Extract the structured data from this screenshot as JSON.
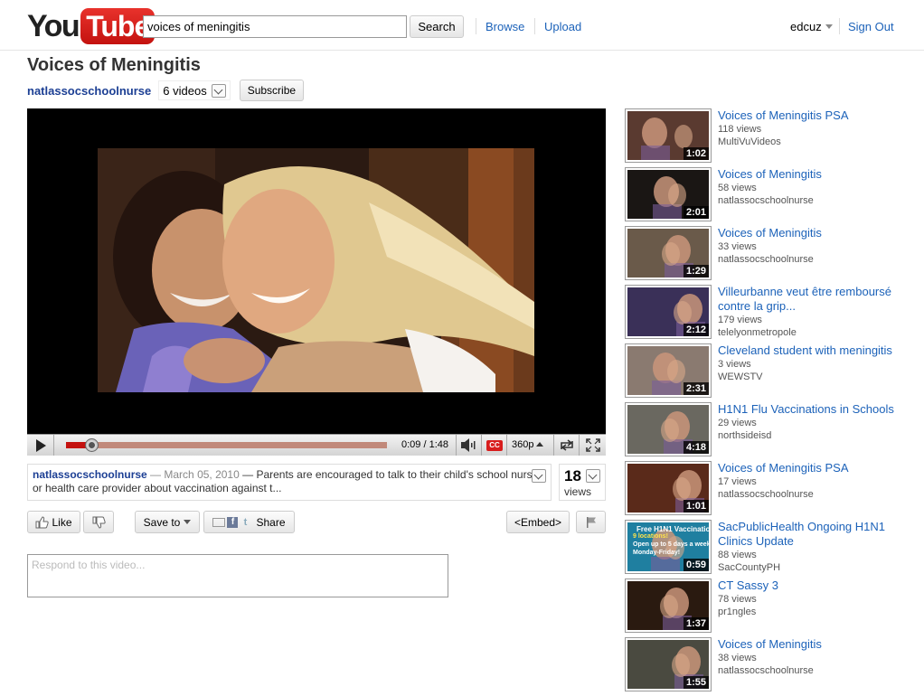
{
  "header": {
    "logo_you": "You",
    "logo_tube": "Tube",
    "search_value": "voices of meningitis",
    "search_button": "Search",
    "browse": "Browse",
    "upload": "Upload",
    "username": "edcuz",
    "sign_out": "Sign Out"
  },
  "video": {
    "title": "Voices of Meningitis",
    "channel": "natlassocschoolnurse",
    "video_count": "6 videos",
    "subscribe": "Subscribe",
    "time": "0:09 / 1:48",
    "progress": 0.083,
    "cc": "CC",
    "quality": "360p"
  },
  "description": {
    "channel": "natlassocschoolnurse",
    "sep1": " — ",
    "date": "March 05, 2010",
    "sep2": " — ",
    "text": "Parents are encouraged to talk to their child's school nurse or health care provider about vaccination against t..."
  },
  "views": {
    "count": "18",
    "label": "views"
  },
  "actions": {
    "like": "Like",
    "save_to": "Save to",
    "share": "Share",
    "embed": "<Embed>"
  },
  "comment": {
    "placeholder": "Respond to this video..."
  },
  "related": [
    {
      "title": "Voices of Meningitis PSA",
      "views": "118 views",
      "user": "MultiVuVideos",
      "duration": "1:02",
      "color": "#5a3a30"
    },
    {
      "title": "Voices of Meningitis",
      "views": "58 views",
      "user": "natlassocschoolnurse",
      "duration": "2:01",
      "color": "#1a1614"
    },
    {
      "title": "Voices of Meningitis",
      "views": "33 views",
      "user": "natlassocschoolnurse",
      "duration": "1:29",
      "color": "#6a5a4a"
    },
    {
      "title": "Villeurbanne veut être remboursé contre la grip...",
      "views": "179 views",
      "user": "telelyonmetropole",
      "duration": "2:12",
      "color": "#3a3058"
    },
    {
      "title": "Cleveland student with meningitis",
      "views": "3 views",
      "user": "WEWSTV",
      "duration": "2:31",
      "color": "#8a7a70"
    },
    {
      "title": "H1N1 Flu Vaccinations in Schools",
      "views": "29 views",
      "user": "northsideisd",
      "duration": "4:18",
      "color": "#6a6860"
    },
    {
      "title": "Voices of Meningitis PSA",
      "views": "17 views",
      "user": "natlassocschoolnurse",
      "duration": "1:01",
      "color": "#5a2a1a"
    },
    {
      "title": "SacPublicHealth Ongoing H1N1 Clinics Update",
      "views": "88 views",
      "user": "SacCountyPH",
      "duration": "0:59",
      "color": "#1f7fa0",
      "overlay_lines": [
        "Free H1N1 Vaccinations",
        "9 locations!",
        "Open up to 5 days a week,",
        "Monday-Friday!"
      ]
    },
    {
      "title": "CT Sassy 3",
      "views": "78 views",
      "user": "pr1ngles",
      "duration": "1:37",
      "color": "#2a1a10"
    },
    {
      "title": "Voices of Meningitis",
      "views": "38 views",
      "user": "natlassocschoolnurse",
      "duration": "1:55",
      "color": "#4a4a40"
    }
  ]
}
